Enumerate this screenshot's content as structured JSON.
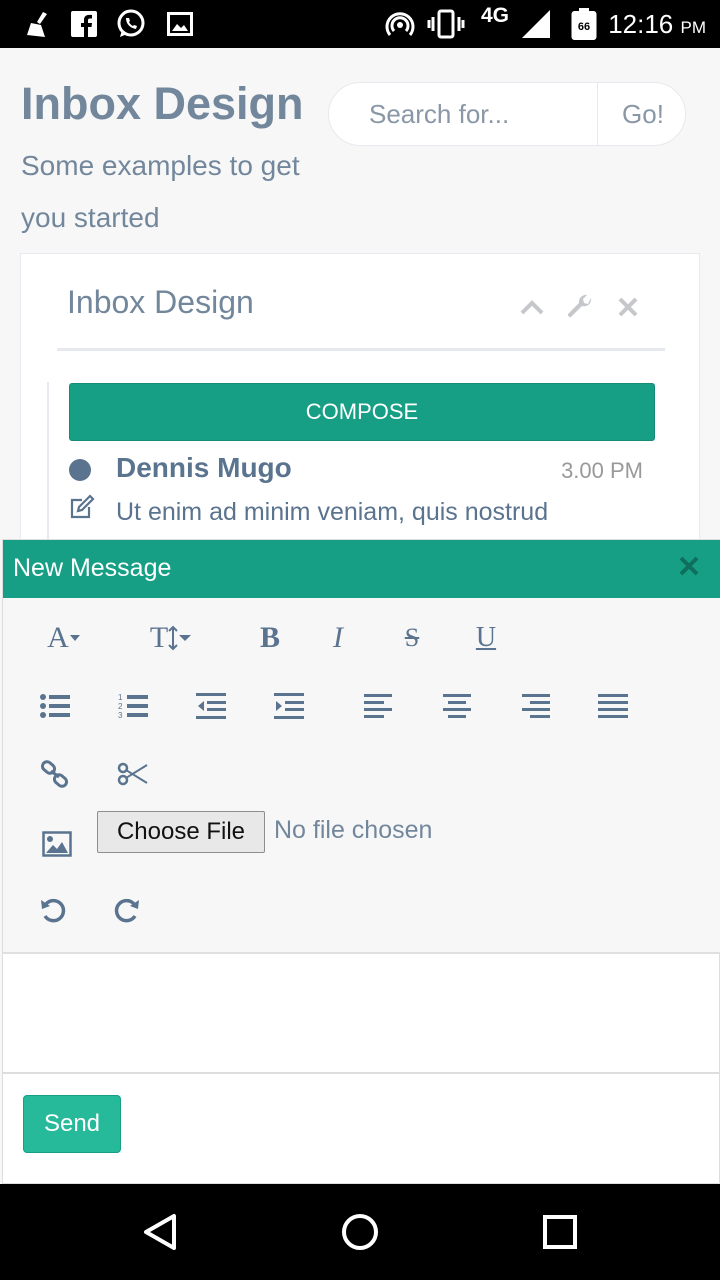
{
  "status_bar": {
    "time": "12:16",
    "time_suffix": "PM",
    "network": "4G",
    "battery_level": "66",
    "icons": [
      "cleaner-icon",
      "facebook-icon",
      "whatsapp-icon",
      "image-icon",
      "hotspot-icon",
      "vibrate-icon",
      "signal-icon",
      "battery-icon"
    ]
  },
  "header": {
    "title": "Inbox Design",
    "subtitle": "Some examples to get you started"
  },
  "search": {
    "placeholder": "Search for...",
    "button_label": "Go!"
  },
  "panel": {
    "title": "Inbox Design",
    "tools": [
      "chevron-up-icon",
      "wrench-icon",
      "close-icon"
    ],
    "compose_label": "COMPOSE",
    "mail": {
      "sender": "Dennis Mugo",
      "time": "3.00 PM",
      "preview": "Ut enim ad minim veniam, quis nostrud"
    }
  },
  "compose_modal": {
    "title": "New Message",
    "toolbar": {
      "font_label": "A",
      "text_height_label": "T",
      "bold_label": "B",
      "italic_label": "I",
      "strikethrough_label": "S",
      "underline_label": "U"
    },
    "file": {
      "button_label": "Choose File",
      "status": "No file chosen"
    },
    "send_label": "Send"
  },
  "colors": {
    "accent": "#169f85",
    "send": "#26b99a",
    "text": "#73879c",
    "icon": "#5a738e"
  },
  "nav_bar": [
    "back-icon",
    "home-icon",
    "recents-icon"
  ]
}
